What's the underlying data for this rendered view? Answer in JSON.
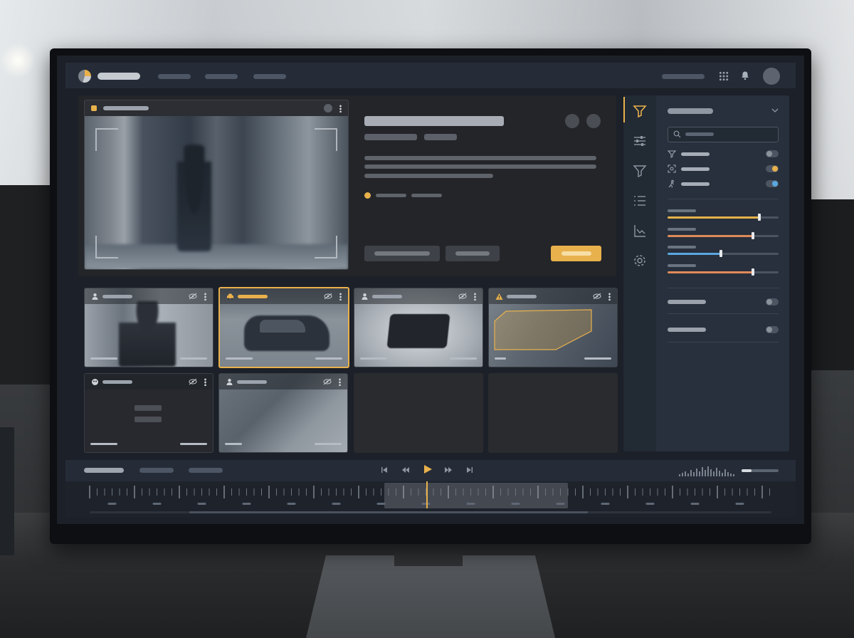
{
  "topbar": {
    "app_title": "",
    "nav": [
      "",
      "",
      ""
    ],
    "user_label": ""
  },
  "preview": {
    "camera_label": "",
    "title": "",
    "tags": [
      "",
      ""
    ],
    "description_lines": [
      "",
      "",
      ""
    ],
    "status_labels": [
      "",
      ""
    ],
    "buttons": {
      "secondary_1": "",
      "secondary_2": "",
      "primary": ""
    }
  },
  "thumbnails": [
    {
      "label": "",
      "icon": "person-icon",
      "selected": false
    },
    {
      "label": "",
      "icon": "car-icon",
      "selected": true
    },
    {
      "label": "",
      "icon": "person-icon",
      "selected": false
    },
    {
      "label": "",
      "icon": "warning-icon",
      "selected": false
    },
    {
      "label": "",
      "icon": "face-mask-icon",
      "selected": false
    },
    {
      "label": "",
      "icon": "person-icon",
      "selected": false
    }
  ],
  "side_rail": [
    "filter-icon",
    "sliders-icon",
    "funnel-icon",
    "list-settings-icon",
    "chart-icon",
    "gear-icon"
  ],
  "filter_panel": {
    "title": "",
    "search_placeholder": "",
    "filters": [
      {
        "label": "",
        "icon": "filter-icon",
        "on": false
      },
      {
        "label": "",
        "icon": "focus-icon",
        "on": true
      },
      {
        "label": "",
        "icon": "motion-icon",
        "on": true
      }
    ],
    "sliders": [
      {
        "label": "",
        "level": 0.83,
        "color": "#e6b24a"
      },
      {
        "label": "",
        "level": 0.77,
        "color": "#e08a5a"
      },
      {
        "label": "",
        "level": 0.48,
        "color": "#5aa7e0"
      },
      {
        "label": "",
        "level": 0.77,
        "color": "#e08a5a"
      }
    ],
    "toggles": [
      {
        "label": "",
        "on": false
      },
      {
        "label": "",
        "on": false
      }
    ]
  },
  "timeline": {
    "tabs": [
      "",
      "",
      ""
    ],
    "controls": [
      "skip-start-icon",
      "rewind-icon",
      "play-icon",
      "fast-forward-icon",
      "skip-end-icon"
    ]
  },
  "colors": {
    "accent": "#e8b14c",
    "panel": "#27303c",
    "background": "#1c2028"
  }
}
